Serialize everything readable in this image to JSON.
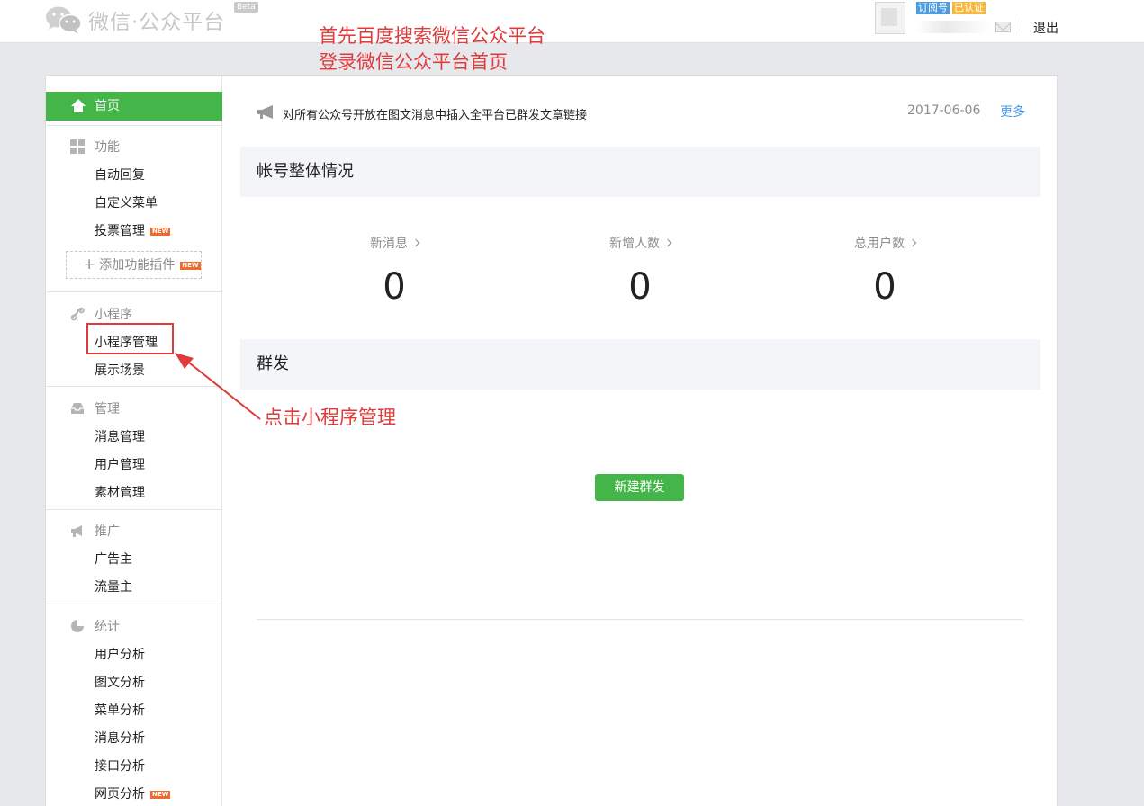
{
  "header": {
    "logo_text": "微信·公众平台",
    "beta": "Beta",
    "account_type_badge": "订阅号",
    "verified_badge": "已认证",
    "logout": "退出"
  },
  "annotations": {
    "top_line1": "首先百度搜索微信公众平台",
    "top_line2": "登录微信公众平台首页",
    "arrow_note": "点击小程序管理"
  },
  "sidebar": {
    "home": "首页",
    "groups": {
      "features": {
        "label": "功能",
        "items": [
          "自动回复",
          "自定义菜单",
          "投票管理"
        ],
        "plugin_button": "添加功能插件"
      },
      "miniprogram": {
        "label": "小程序",
        "items": [
          "小程序管理",
          "展示场景"
        ]
      },
      "manage": {
        "label": "管理",
        "items": [
          "消息管理",
          "用户管理",
          "素材管理"
        ]
      },
      "promote": {
        "label": "推广",
        "items": [
          "广告主",
          "流量主"
        ]
      },
      "stats": {
        "label": "统计",
        "items": [
          "用户分析",
          "图文分析",
          "菜单分析",
          "消息分析",
          "接口分析",
          "网页分析"
        ]
      }
    },
    "new_badge": "NEW"
  },
  "main": {
    "notice": {
      "text": "对所有公众号开放在图文消息中插入全平台已群发文章链接",
      "date": "2017-06-06",
      "more": "更多"
    },
    "overview": {
      "title": "帐号整体情况",
      "stats": [
        {
          "label": "新消息",
          "value": "0"
        },
        {
          "label": "新增人数",
          "value": "0"
        },
        {
          "label": "总用户数",
          "value": "0"
        }
      ]
    },
    "broadcast": {
      "title": "群发",
      "button": "新建群发"
    }
  },
  "colors": {
    "accent_green": "#44b549",
    "annotation_red": "#e03a3a",
    "link_blue": "#459ae9"
  }
}
